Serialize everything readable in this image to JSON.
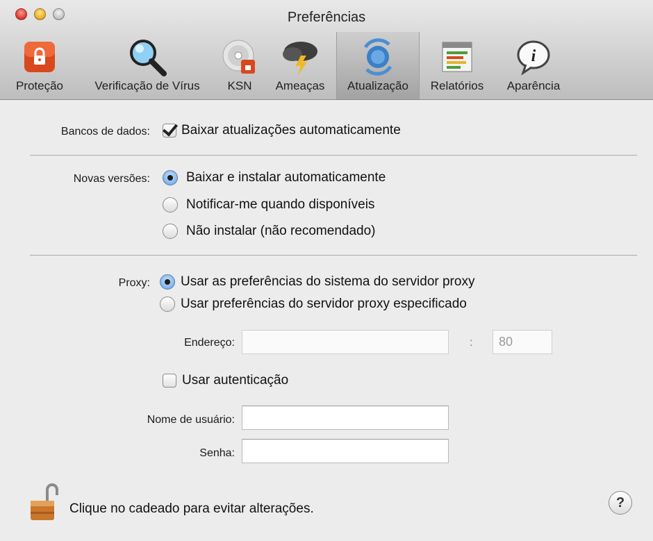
{
  "window": {
    "title": "Preferências"
  },
  "toolbar": {
    "items": [
      {
        "label": "Proteção",
        "icon": "lock-shield-icon"
      },
      {
        "label": "Verificação de Vírus",
        "icon": "magnifier-icon"
      },
      {
        "label": "KSN",
        "icon": "disc-icon"
      },
      {
        "label": "Ameaças",
        "icon": "storm-cloud-icon"
      },
      {
        "label": "Atualização",
        "icon": "update-globe-icon",
        "active": true
      },
      {
        "label": "Relatórios",
        "icon": "report-icon"
      },
      {
        "label": "Aparência",
        "icon": "info-icon"
      }
    ]
  },
  "databases": {
    "label": "Bancos de dados:",
    "auto_update_label": "Baixar atualizações automaticamente",
    "auto_update_checked": true
  },
  "new_versions": {
    "label": "Novas versões:",
    "options": [
      {
        "label": "Baixar e instalar automaticamente",
        "selected": true
      },
      {
        "label": "Notificar-me quando disponíveis",
        "selected": false
      },
      {
        "label": "Não instalar (não recomendado)",
        "selected": false
      }
    ]
  },
  "proxy": {
    "label": "Proxy:",
    "options": [
      {
        "label": "Usar as preferências do sistema do servidor proxy",
        "selected": true
      },
      {
        "label": "Usar preferências do servidor proxy especificado",
        "selected": false
      }
    ],
    "address_label": "Endereço:",
    "address_value": "",
    "port_separator": ":",
    "port_value": "80",
    "auth_label": "Usar autenticação",
    "auth_checked": false,
    "username_label": "Nome de usuário:",
    "username_value": "",
    "password_label": "Senha:",
    "password_value": ""
  },
  "footer": {
    "lock_text": "Clique no cadeado para evitar alterações.",
    "help_label": "?"
  },
  "colors": {
    "accent": "#e2413a",
    "radio_selected": "#7db4ec",
    "background": "#ececec"
  }
}
